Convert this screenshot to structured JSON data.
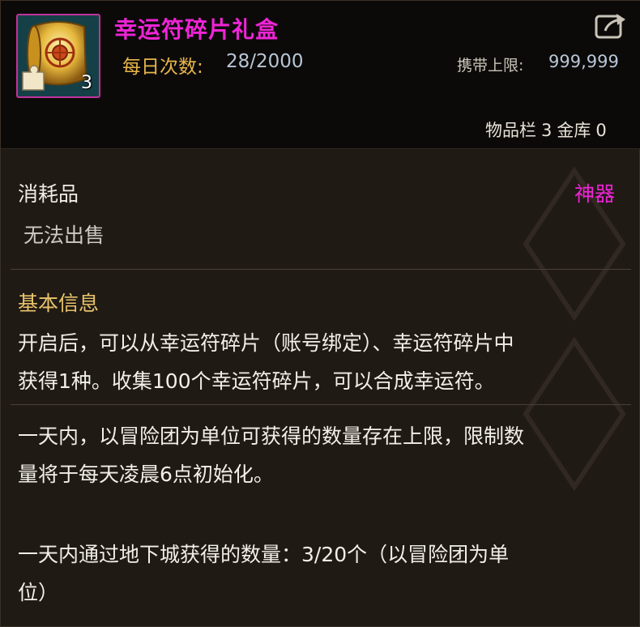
{
  "item": {
    "name": "幸运符碎片礼盒",
    "icon": "scroll-puzzle-icon",
    "stack_count": "3",
    "daily_label": "每日次数:",
    "daily_value": "28/2000",
    "carry_label": "携带上限:",
    "carry_value": "999,999"
  },
  "inventory": {
    "bag_label": "物品栏",
    "bag_count": "3",
    "vault_label": "金库",
    "vault_count": "0"
  },
  "info": {
    "category": "消耗品",
    "rarity": "神器",
    "sell_status": "无法出售",
    "section_title": "基本信息",
    "description_lines": [
      "开启后，可以从幸运符碎片（账号绑定）、幸运符碎片中",
      "获得1种。收集100个幸运符碎片，可以合成幸运符。"
    ],
    "limit_lines": [
      "一天内，以冒险团为单位可获得的数量存在上限，限制数",
      "量将于每天凌晨6点初始化。"
    ],
    "dungeon_lines": [
      "一天内通过地下城获得的数量：3/20个（以冒险团为单",
      "位）"
    ]
  },
  "colors": {
    "rarity": "#ef24d6",
    "label_gold": "#e8b64a",
    "value_blue": "#b8c6d6"
  }
}
